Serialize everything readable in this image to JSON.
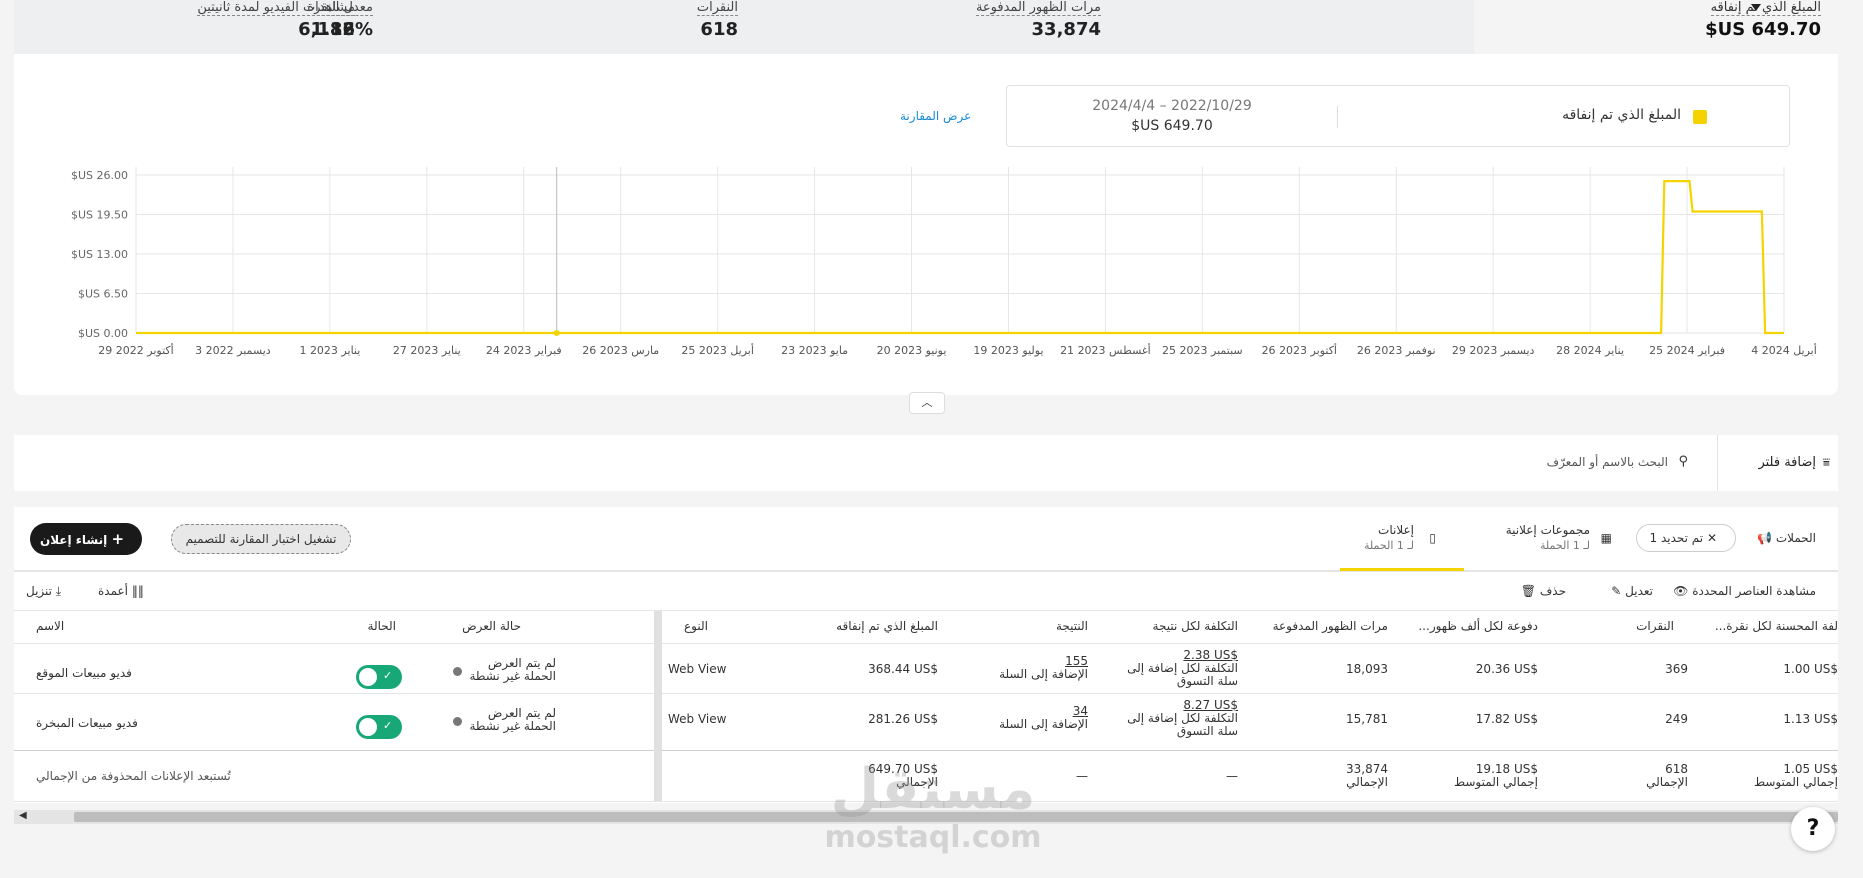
{
  "metrics": {
    "selected": {
      "label": "المبلغ الذي تم إنفاقه",
      "value": "$US 649.70"
    },
    "impressions": {
      "label": "مرات الظهور المدفوعة",
      "value": "33,874"
    },
    "clicks": {
      "label": "النقرات",
      "value": "618"
    },
    "ctr": {
      "label": "معدل النقرة",
      "value": "1.82%"
    },
    "video_views": {
      "label": "مشاهدات الفيديو لمدة ثانيتين",
      "value": "6,116"
    }
  },
  "legend": {
    "series_name": "المبلغ الذي تم إنفاقه",
    "date_range": "2024/4/4 – 2022/10/29",
    "total": "$US 649.70",
    "swatch_color": "#f5d300"
  },
  "compare_link": "عرض المقارنة",
  "chart_data": {
    "type": "line",
    "x": [
      "29 أكتوبر 2022",
      "3 ديسمبر 2022",
      "1 يناير 2023",
      "27 يناير 2023",
      "24 فبراير 2023",
      "26 مارس 2023",
      "25 أبريل 2023",
      "23 مايو 2023",
      "20 يونيو 2023",
      "19 يوليو 2023",
      "21 أغسطس 2023",
      "25 سبتمبر 2023",
      "26 أكتوبر 2023",
      "26 نوفمبر 2023",
      "29 ديسمبر 2023",
      "28 يناير 2024",
      "25 فبراير 2024",
      "4 أبريل 2024"
    ],
    "y_ticks": [
      "$US 26.00",
      "$US 19.50",
      "$US 13.00",
      "$US 6.50",
      "$US 0.00"
    ],
    "ylim": [
      0,
      26
    ],
    "series": [
      {
        "color": "#f5d300",
        "points": [
          [
            "2022-10-29",
            0
          ],
          [
            "2024-02-25",
            0
          ],
          [
            "2024-02-26",
            25.0
          ],
          [
            "2024-03-05",
            25.0
          ],
          [
            "2024-03-06",
            20.0
          ],
          [
            "2024-03-28",
            20.0
          ],
          [
            "2024-03-29",
            0
          ],
          [
            "2024-04-04",
            0
          ]
        ]
      }
    ],
    "grid": true
  },
  "filter": {
    "add_filter": "إضافة فلتر",
    "search_placeholder": "البحث بالاسم أو المعرّف"
  },
  "tabs": {
    "campaigns": "الحملات",
    "campaigns_chip": "تم تحديد 1",
    "ad_groups": "مجموعات إعلانية",
    "ad_groups_sub": "لـ 1 الحملة",
    "ads": "إعلانات",
    "ads_sub": "لـ 1 الحملة"
  },
  "actions": {
    "ab_test": "تشغيل اختبار المقارنة للتصميم",
    "create_ad": "إنشاء إعلان"
  },
  "toolbar": {
    "view_selected": "مشاهدة العناصر المحددة",
    "edit": "تعديل",
    "delete": "حذف",
    "columns": "أعمدة",
    "download": "تنزيل"
  },
  "table": {
    "headers": {
      "name": "الاسم",
      "status": "الحالة",
      "delivery": "حالة العرض",
      "type": "النوع",
      "spend": "المبلغ الذي تم إنفاقه",
      "result": "النتيجة",
      "cost_per_result": "التكلفة لكل نتيجة",
      "impressions": "مرات الظهور المدفوعة",
      "cpm": "...دفوعة لكل ألف ظهور",
      "clicks": "النقرات",
      "cpc": "...لفة المحسنة لكل نقرة"
    },
    "rows": [
      {
        "name": "فديو مبيعات الموقع",
        "delivery_1": "لم يتم العرض",
        "delivery_2": "الحملة غير نشطة",
        "type": "Web View",
        "spend": "368.44 US$",
        "result_value": "155",
        "result_label": "الإضافة إلى السلة",
        "cpr_value": "2.38 US$",
        "cpr_label_1": "التكلفة لكل إضافة إلى",
        "cpr_label_2": "سلة التسوق",
        "impressions": "18,093",
        "cpm": "20.36 US$",
        "clicks": "369",
        "cpc": "1.00 US$"
      },
      {
        "name": "فديو مبيعات المبخرة",
        "delivery_1": "لم يتم العرض",
        "delivery_2": "الحملة غير نشطة",
        "type": "Web View",
        "spend": "281.26 US$",
        "result_value": "34",
        "result_label": "الإضافة إلى السلة",
        "cpr_value": "8.27 US$",
        "cpr_label_1": "التكلفة لكل إضافة إلى",
        "cpr_label_2": "سلة التسوق",
        "impressions": "15,781",
        "cpm": "17.82 US$",
        "clicks": "249",
        "cpc": "1.13 US$"
      }
    ],
    "totals": {
      "note": "تُستبعد الإعلانات المحذوفة من الإجمالي",
      "spend": "649.70 US$",
      "spend_label": "الإجمالي",
      "result": "—",
      "cpr": "—",
      "impressions": "33,874",
      "impressions_label": "الإجمالي",
      "cpm": "19.18 US$",
      "cpm_label": "إجمالي المتوسط",
      "clicks": "618",
      "clicks_label": "الإجمالي",
      "cpc": "1.05 US$",
      "cpc_label": "إجمالي المتوسط"
    }
  },
  "watermark": {
    "line1": "مستقل",
    "line2": "mostaql.com"
  }
}
